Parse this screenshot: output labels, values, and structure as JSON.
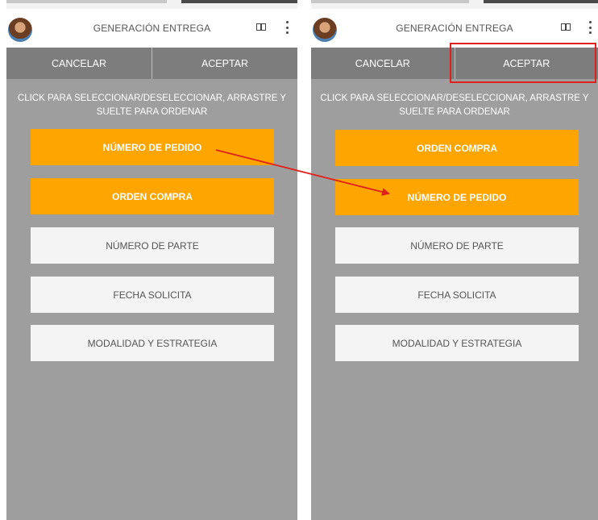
{
  "left": {
    "title": "GENERACIÓN ENTREGA",
    "cancel_label": "CANCELAR",
    "accept_label": "ACEPTAR",
    "instructions": "CLICK PARA SELECCIONAR/DESELECCIONAR, ARRASTRE Y SUELTE PARA ORDENAR",
    "items": [
      {
        "label": "NÚMERO DE PEDIDO",
        "selected": true
      },
      {
        "label": "ORDEN COMPRA",
        "selected": true
      },
      {
        "label": "NÚMERO DE PARTE",
        "selected": false
      },
      {
        "label": "FECHA SOLICITA",
        "selected": false
      },
      {
        "label": "MODALIDAD Y ESTRATEGIA",
        "selected": false
      }
    ]
  },
  "right": {
    "title": "GENERACIÓN ENTREGA",
    "cancel_label": "CANCELAR",
    "accept_label": "ACEPTAR",
    "instructions": "CLICK PARA SELECCIONAR/DESELECCIONAR, ARRASTRE Y SUELTE PARA ORDENAR",
    "items": [
      {
        "label": "ORDEN COMPRA",
        "selected": true
      },
      {
        "label": "NÚMERO DE PEDIDO",
        "selected": true
      },
      {
        "label": "NÚMERO DE PARTE",
        "selected": false
      },
      {
        "label": "FECHA SOLICITA",
        "selected": false
      },
      {
        "label": "MODALIDAD Y ESTRATEGIA",
        "selected": false
      }
    ]
  },
  "colors": {
    "panel_bg": "#9e9e9e",
    "selected_item": "#ffa500",
    "unselected_item": "#f4f4f4",
    "action_bar": "#7d7d7d",
    "annotation": "#e0201c"
  },
  "icons": [
    "avatar",
    "split-panel-icon",
    "more-vert-icon"
  ]
}
